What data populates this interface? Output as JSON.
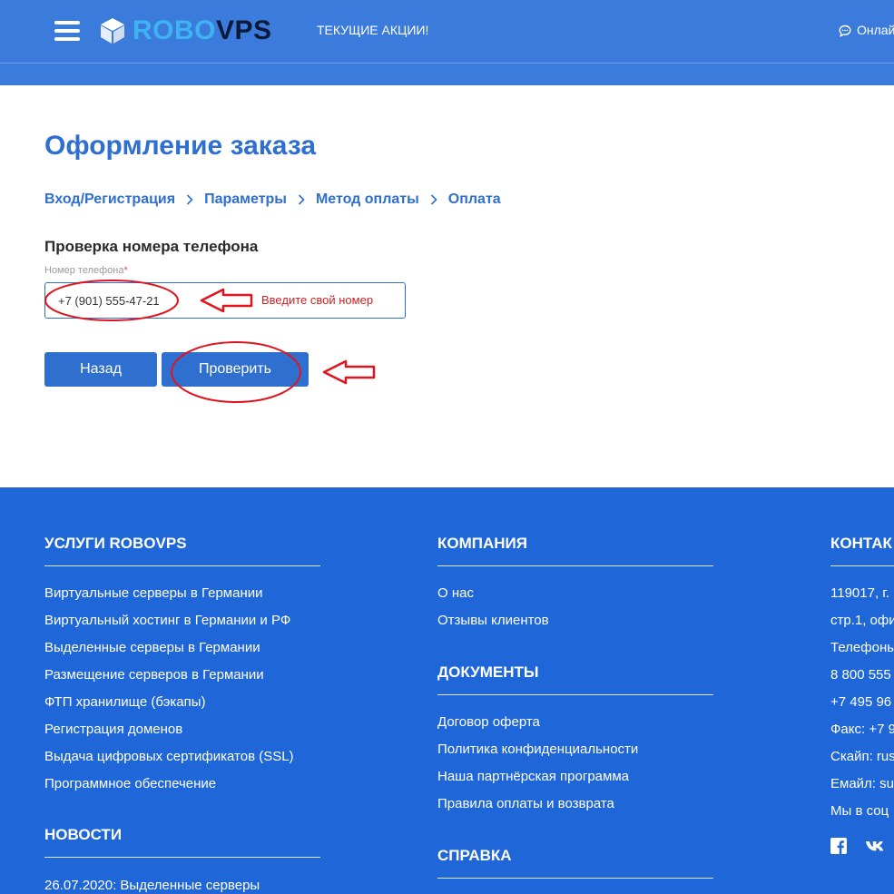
{
  "header": {
    "logo_robo": "ROBO",
    "logo_vps": "VPS",
    "promo": "ТЕКУЩИЕ АКЦИИ!",
    "online": "Онлай"
  },
  "main": {
    "title": "Оформление заказа",
    "breadcrumb": [
      "Вход/Регистрация",
      "Параметры",
      "Метод оплаты",
      "Оплата"
    ],
    "section_title": "Проверка номера телефона",
    "phone_label": "Номер телефона",
    "required_mark": "*",
    "phone_value": "+7 (901) 555-47-21",
    "hint": "Введите свой номер",
    "back_button": "Назад",
    "check_button": "Проверить"
  },
  "footer": {
    "services": {
      "title": "УСЛУГИ ROBOVPS",
      "items": [
        "Виртуальные серверы в Германии",
        "Виртуальный хостинг в Германии и РФ",
        "Выделенные серверы в Германии",
        "Размещение серверов в Германии",
        "ФТП хранилище (бэкапы)",
        "Регистрация доменов",
        "Выдача цифровых сертификатов (SSL)",
        "Программное обеспечение"
      ]
    },
    "news": {
      "title": "НОВОСТИ",
      "items": [
        "26.07.2020: Выделенные серверы"
      ]
    },
    "company": {
      "title": "КОМПАНИЯ",
      "items": [
        "О нас",
        "Отзывы клиентов"
      ]
    },
    "documents": {
      "title": "ДОКУМЕНТЫ",
      "items": [
        "Договор оферта",
        "Политика конфиденциальности",
        "Наша партнёрская программа",
        "Правила оплаты и возврата"
      ]
    },
    "help": {
      "title": "СПРАВКА"
    },
    "contacts": {
      "title": "КОНТАК",
      "lines": [
        "119017, г.",
        "стр.1, офи",
        "Телефоны",
        "8 800 555",
        "+7 495 96",
        "Факс: +7 9",
        "Скайп: rus",
        "Емайл: su",
        "Мы в соц"
      ]
    }
  },
  "icons": {
    "menu": "hamburger-icon",
    "logo": "cube-icon",
    "chat": "chat-bubble-icon",
    "facebook": "facebook-icon",
    "vk": "vk-icon"
  },
  "colors": {
    "header_bg": "#3a7bdc",
    "accent": "#2f6fd0",
    "footer_bg": "#1f67d8",
    "annotation_red": "#e0141c"
  }
}
